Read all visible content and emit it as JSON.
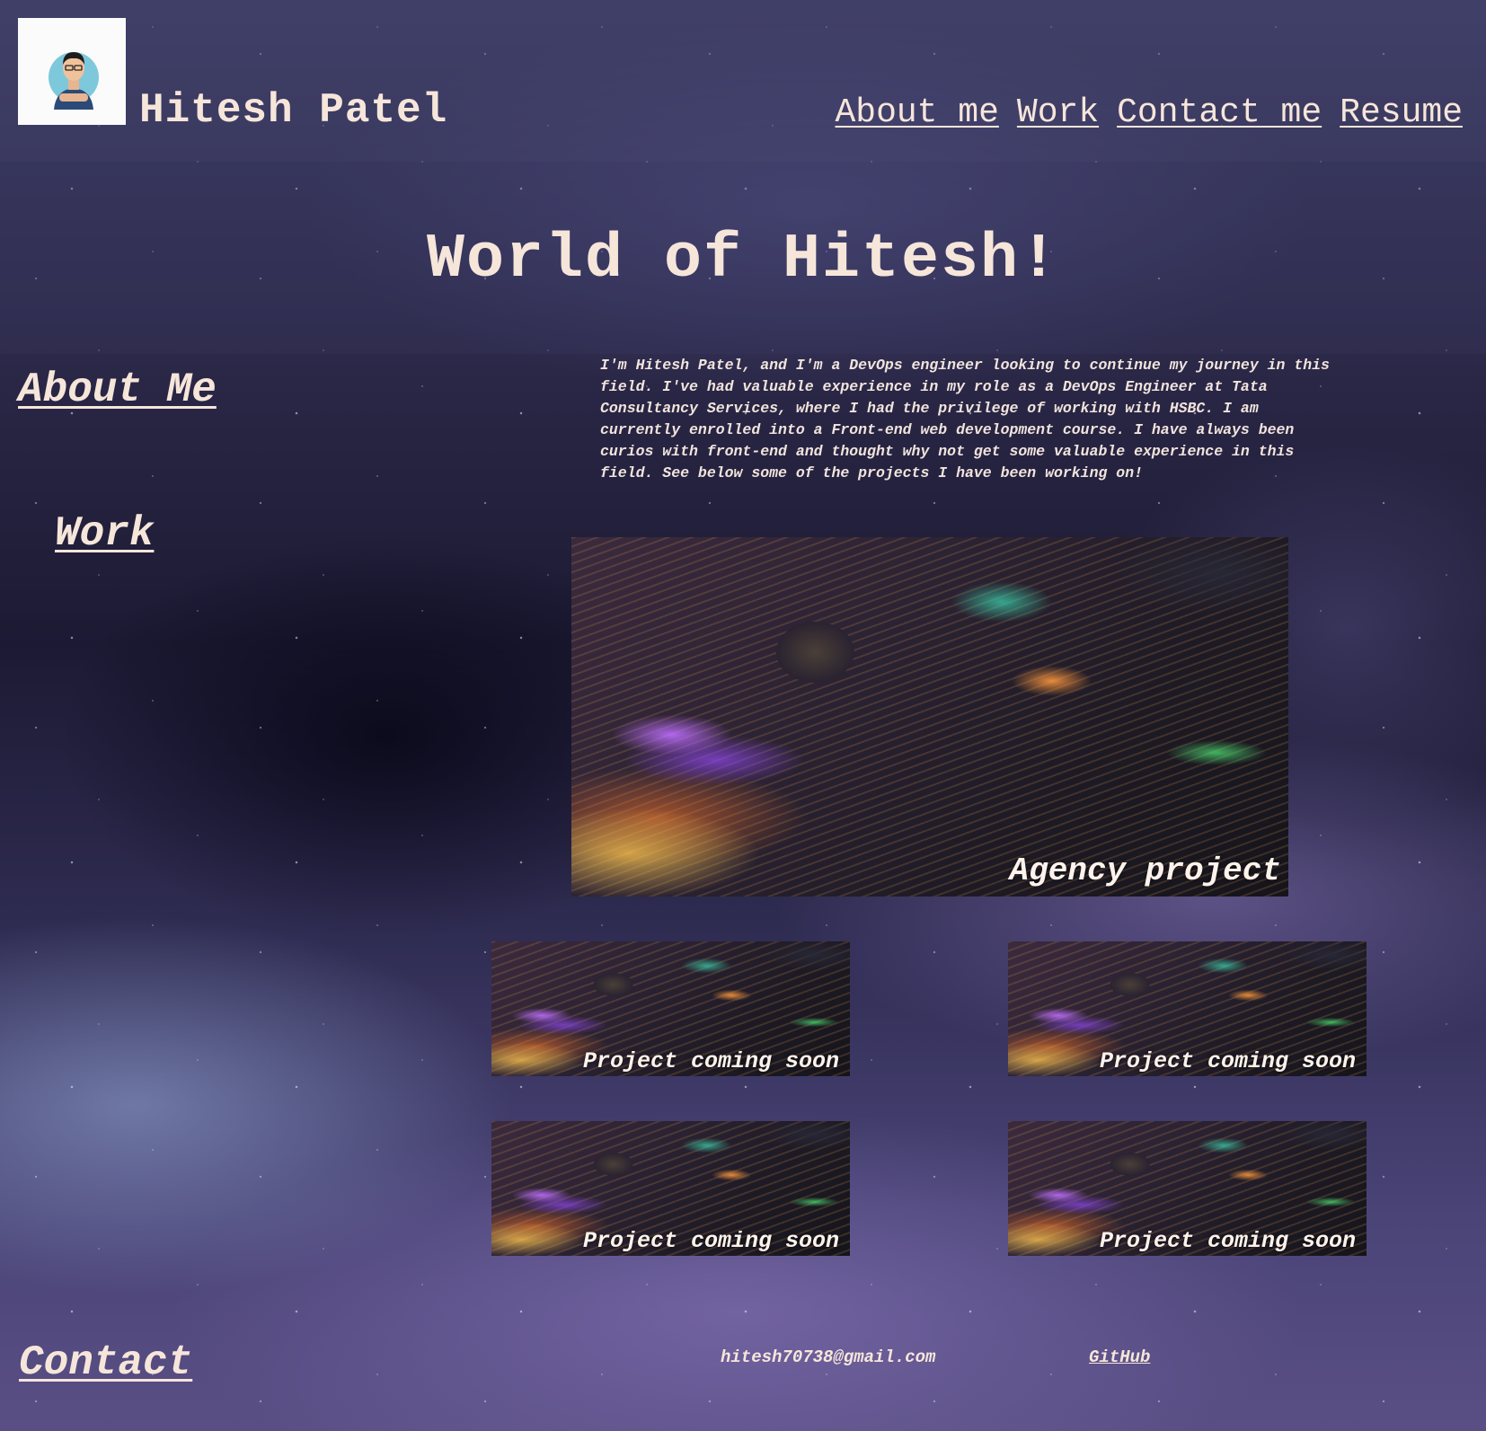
{
  "header": {
    "avatar_icon": "person-avatar-icon",
    "name": "Hitesh Patel",
    "nav": [
      {
        "label": "About me"
      },
      {
        "label": "Work"
      },
      {
        "label": "Contact me"
      },
      {
        "label": "Resume"
      }
    ]
  },
  "hero": {
    "title": "World of Hitesh!"
  },
  "about": {
    "heading": "About Me",
    "text": "I'm Hitesh Patel, and I'm a DevOps engineer looking to continue my journey in this field. I've had valuable experience in my role as a DevOps Engineer at Tata Consultancy Services, where I had the privilege of working with HSBC. I am currently enrolled into a Front-end web development course. I have always been curios with front-end and thought why not get some valuable experience in this field. See below some of the projects I have been working on!"
  },
  "work": {
    "heading": "Work",
    "featured": {
      "label": "Agency project"
    },
    "projects": [
      {
        "label": "Project coming soon"
      },
      {
        "label": "Project coming soon"
      },
      {
        "label": "Project coming soon"
      },
      {
        "label": "Project coming soon"
      }
    ]
  },
  "contact": {
    "heading": "Contact",
    "email": "hitesh70738@gmail.com",
    "github_label": "GitHub"
  },
  "colors": {
    "text": "#f6e6da",
    "avatar_bg": "#fbfbfb",
    "avatar_circle": "#7ec8dc",
    "shirt": "#2c4a78"
  }
}
